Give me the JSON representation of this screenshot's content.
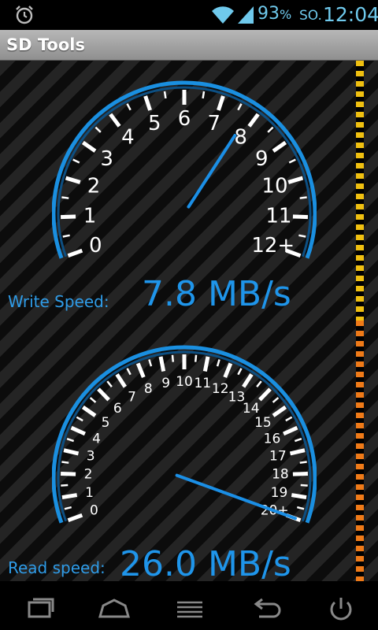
{
  "status_bar": {
    "battery_percent": "93",
    "percent_sign": "%",
    "day": "SO.",
    "time": "12:04",
    "icons": [
      "alarm-icon",
      "wifi-icon",
      "signal-icon"
    ]
  },
  "app": {
    "title": "SD Tools"
  },
  "write_gauge": {
    "labels": [
      "0",
      "1",
      "2",
      "3",
      "4",
      "5",
      "6",
      "7",
      "8",
      "9",
      "10",
      "11",
      "12+"
    ],
    "value": 7.8,
    "max": 12,
    "speed_label": "Write Speed:",
    "speed_value": "7.8 MB/s"
  },
  "read_gauge": {
    "labels": [
      "0",
      "1",
      "2",
      "3",
      "4",
      "5",
      "6",
      "7",
      "8",
      "9",
      "10",
      "11",
      "12",
      "13",
      "14",
      "15",
      "16",
      "17",
      "18",
      "19",
      "20+"
    ],
    "value": 20,
    "max": 20,
    "speed_label": "Read speed:",
    "speed_value": "26.0 MB/s"
  },
  "colors": {
    "accent": "#1f95ea",
    "gauge_ring": "#1a8fe0",
    "strip_upper": "#f0c010",
    "strip_lower": "#ef7a18"
  },
  "nav_bar": {
    "icons": [
      "recent-apps-icon",
      "home-icon",
      "menu-icon",
      "back-icon",
      "power-icon"
    ]
  }
}
